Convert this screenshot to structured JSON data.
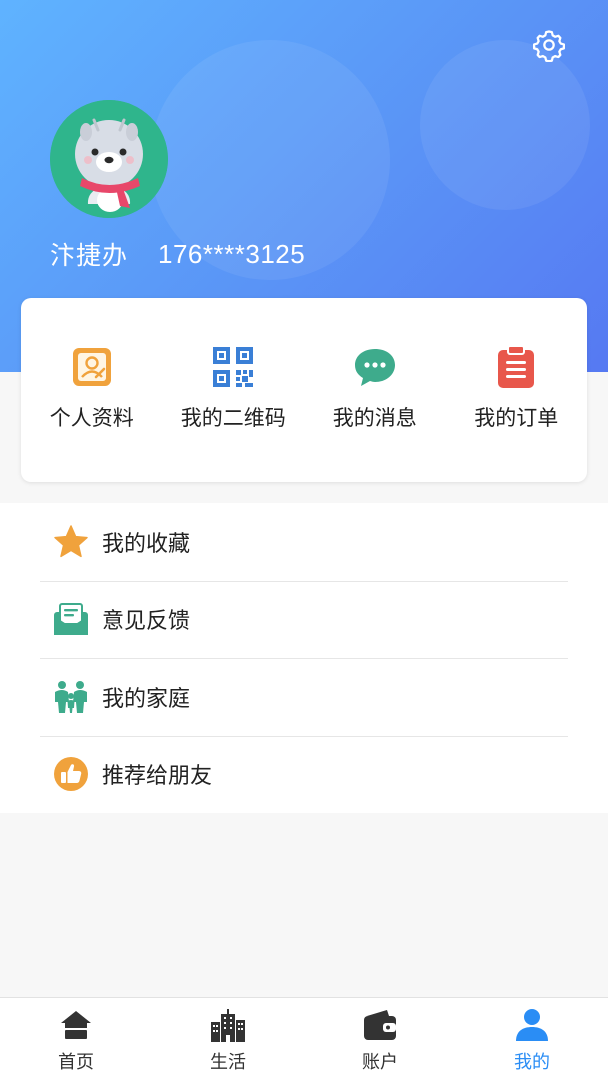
{
  "header": {
    "settings_icon": "gear-icon",
    "user": {
      "name": "汴捷办",
      "phone": "176****3125",
      "avatar": "cartoon-bear-avatar"
    }
  },
  "quick_actions": [
    {
      "label": "个人资料",
      "icon": "profile-card-icon",
      "color": "#f0a23c"
    },
    {
      "label": "我的二维码",
      "icon": "qr-code-icon",
      "color": "#3a7fd6"
    },
    {
      "label": "我的消息",
      "icon": "message-bubble-icon",
      "color": "#3eab8c"
    },
    {
      "label": "我的订单",
      "icon": "clipboard-icon",
      "color": "#e8574b"
    }
  ],
  "menu": [
    {
      "label": "我的收藏",
      "icon": "star-icon",
      "color": "#f0a23c"
    },
    {
      "label": "意见反馈",
      "icon": "feedback-mail-icon",
      "color": "#3eab8c"
    },
    {
      "label": "我的家庭",
      "icon": "family-icon",
      "color": "#3eab8c"
    },
    {
      "label": "推荐给朋友",
      "icon": "thumbs-up-icon",
      "color": "#f0a23c"
    }
  ],
  "tabbar": {
    "active_tab": "我的",
    "active_color": "#2a8df5",
    "tabs": [
      {
        "label": "首页",
        "icon": "home-icon"
      },
      {
        "label": "生活",
        "icon": "city-buildings-icon"
      },
      {
        "label": "账户",
        "icon": "wallet-icon"
      },
      {
        "label": "我的",
        "icon": "person-icon"
      }
    ]
  }
}
